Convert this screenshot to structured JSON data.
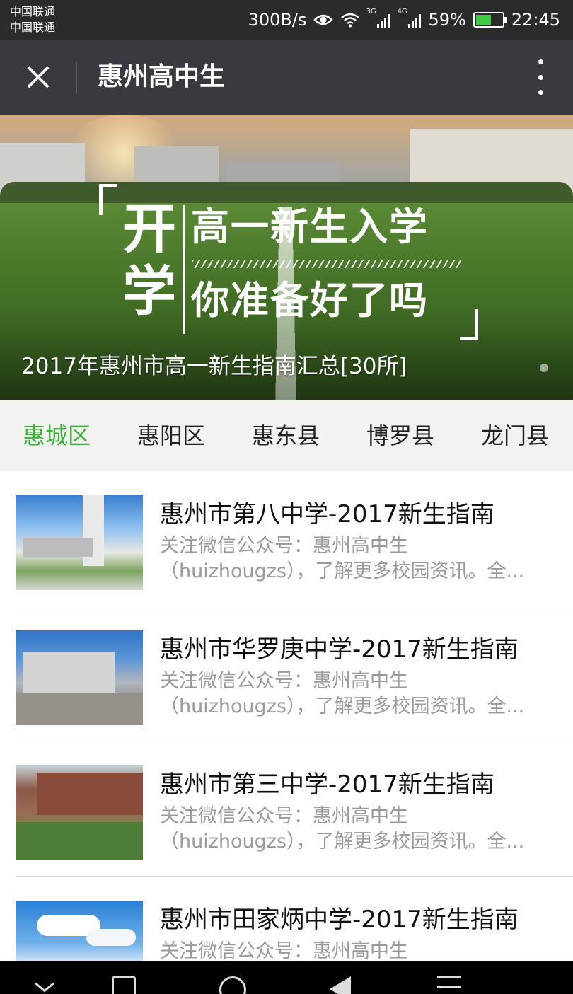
{
  "status_bar": {
    "carrier_1": "中国联通",
    "carrier_2": "中国联通",
    "net_speed": "300B/s",
    "signal_1_label": "3G",
    "signal_2_label": "4G",
    "battery_percent": "59%",
    "battery_level": 0.59,
    "time": "22:45",
    "icons": [
      "eye-icon",
      "wifi-icon",
      "signal-3g-icon",
      "signal-4g-icon",
      "battery-icon"
    ]
  },
  "title_bar": {
    "title": "惠州高中生",
    "close_icon": "close-icon",
    "more_icon": "more-icon"
  },
  "banner": {
    "big_char": "开学",
    "line_1": "高一新生入学",
    "line_2": "你准备好了吗",
    "caption": "2017年惠州市高一新生指南汇总[30所]"
  },
  "tabs": [
    {
      "label": "惠城区",
      "active": true
    },
    {
      "label": "惠阳区",
      "active": false
    },
    {
      "label": "惠东县",
      "active": false
    },
    {
      "label": "博罗县",
      "active": false
    },
    {
      "label": "龙门县",
      "active": false
    }
  ],
  "colors": {
    "active_tab": "#3cb035",
    "title_bar_bg": "#393a3f",
    "status_bar_bg": "#2b2b2b"
  },
  "articles": [
    {
      "title": "惠州市第八中学-2017新生指南",
      "desc_1": "关注微信公众号：惠州高中生",
      "desc_2": "（huizhougzs），了解更多校园资讯。全..."
    },
    {
      "title": "惠州市华罗庚中学-2017新生指南",
      "desc_1": "关注微信公众号：惠州高中生",
      "desc_2": "（huizhougzs），了解更多校园资讯。全..."
    },
    {
      "title": "惠州市第三中学-2017新生指南",
      "desc_1": "关注微信公众号：惠州高中生",
      "desc_2": "（huizhougzs），了解更多校园资讯。全..."
    },
    {
      "title": "惠州市田家炳中学-2017新生指南",
      "desc_1": "关注微信公众号：惠州高中生",
      "desc_2": ""
    }
  ],
  "nav_bar": {
    "icons": [
      "hide-icon",
      "recent-apps-icon",
      "home-icon",
      "back-icon",
      "menu-icon"
    ]
  }
}
